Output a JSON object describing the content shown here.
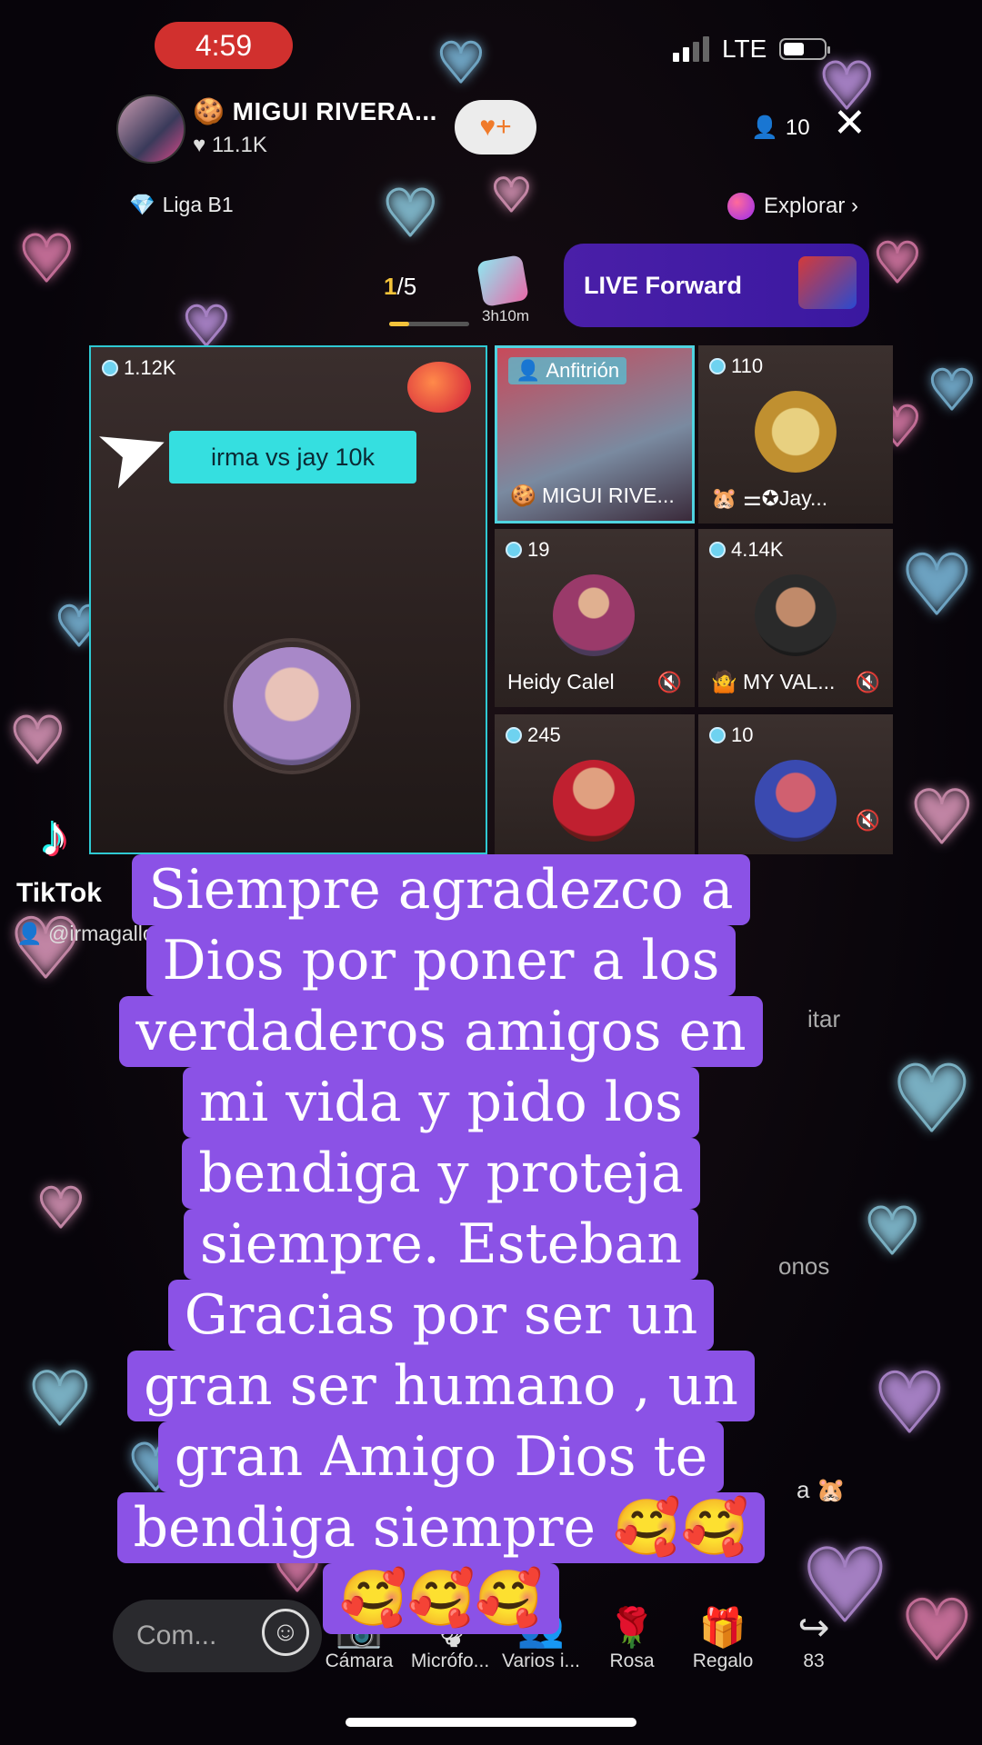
{
  "status_bar": {
    "time": "4:59",
    "network": "LTE"
  },
  "header": {
    "host_name": "🍪 MIGUI RIVERA...",
    "likes": "♥ 11.1K",
    "viewers": "10",
    "league": "Liga B1",
    "explore": "Explorar ›"
  },
  "session": {
    "page_current": "1",
    "page_total": "/5",
    "page_progress": 0.25,
    "timer": "3h10m",
    "live_forward": "LIVE Forward"
  },
  "main_tile": {
    "score": "1.12K",
    "banner": "irma vs jay 10k"
  },
  "tiles": [
    {
      "score": "Anfitrión",
      "name": "🍪 MIGUI RIVE..."
    },
    {
      "score": "110",
      "name": "🐹 ⚌✪Jay..."
    },
    {
      "score": "19",
      "name": "Heidy Calel"
    },
    {
      "score": "4.14K",
      "name": "🤷 MY VAL..."
    },
    {
      "score": "245",
      "name": ""
    },
    {
      "score": "10",
      "name": ""
    }
  ],
  "watermark": {
    "brand": "TikTok",
    "user": "@irmagallo2019"
  },
  "caption_lines": [
    "Siempre agradezco a",
    "Dios por poner a los",
    "verdaderos amigos en",
    "mi vida y pido los",
    "bendiga y proteja",
    "siempre.  Esteban",
    "Gracias por ser un",
    "gran ser humano , un",
    "gran Amigo Dios te",
    "bendiga siempre 🥰🥰",
    "🥰🥰🥰"
  ],
  "side_fragments": {
    "right_1": "itar",
    "right_2": "onos",
    "right_3": "a 🐹"
  },
  "bottom_bar": {
    "comment_placeholder": "Com...",
    "actions": [
      {
        "icon": "camera-icon",
        "label": "Cámara"
      },
      {
        "icon": "microphone-icon",
        "label": "Micrófo..."
      },
      {
        "icon": "multi-guest-icon",
        "label": "Varios i..."
      },
      {
        "icon": "rose-icon",
        "label": "Rosa"
      },
      {
        "icon": "gift-icon",
        "label": "Regalo"
      },
      {
        "icon": "share-icon",
        "label": "83"
      }
    ]
  },
  "colors": {
    "caption_bg": "#8b52e6",
    "live_forward_bg": "#4a1fa8",
    "time_pill": "#d1302e",
    "tile_border": "#2fc9d3",
    "banner": "#35dfe0"
  }
}
